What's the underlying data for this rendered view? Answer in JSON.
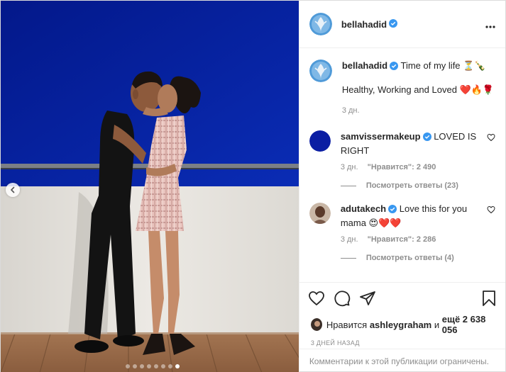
{
  "colors": {
    "wall": "#041f9c",
    "text": "#262626",
    "muted": "#8e8e8e",
    "verified": "#3897f0",
    "accent": "#ed4956"
  },
  "header": {
    "username": "bellahadid",
    "more_label": "•••"
  },
  "caption": {
    "username": "bellahadid",
    "text": "Time of my life ⏳🍾",
    "line2": "Healthy, Working and Loved ❤️🔥🌹",
    "time": "3 дн."
  },
  "comments": [
    {
      "username": "samvissermakeup",
      "text": "LOVED IS RIGHT",
      "time": "3 дн.",
      "likes": "\"Нравится\": 2 490",
      "replies": "Посмотреть ответы (23)"
    },
    {
      "username": "adutakech",
      "text": "Love this for you mama 😍❤️❤️",
      "time": "3 дн.",
      "likes": "\"Нравится\": 2 286",
      "replies": "Посмотреть ответы (4)"
    }
  ],
  "likes": {
    "prefix": "Нравится",
    "user": "ashleygraham",
    "middle": "и",
    "rest": "ещё 2 638 056"
  },
  "post_date": "3 ДНЕЙ НАЗАД",
  "comments_limited": "Комментарии к этой публикации ограничены.",
  "carousel": {
    "count": 8,
    "active": 7
  },
  "icons": [
    "gear-like-avatar",
    "verified-badge-icon",
    "more-icon",
    "heart-icon",
    "comment-icon",
    "share-icon",
    "save-icon",
    "chevron-left-icon"
  ]
}
